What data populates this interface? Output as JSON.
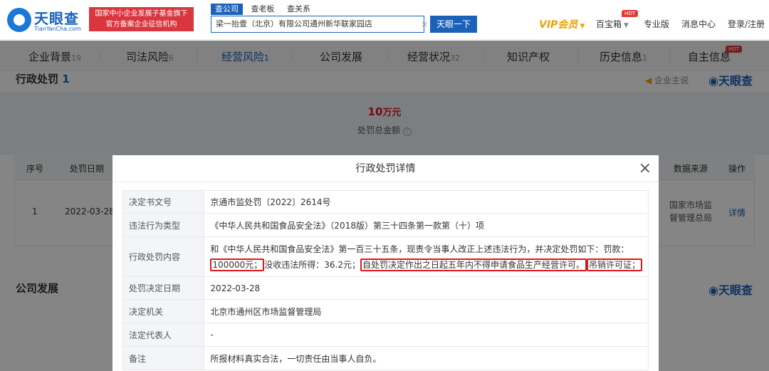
{
  "header": {
    "logo_name": "天眼查",
    "logo_domain": "TianYanCha.com",
    "slogan_line1": "国家中小企业发展子基金旗下",
    "slogan_line2": "官方备案企业征信机构",
    "search_tabs": [
      "查公司",
      "查老板",
      "查关系"
    ],
    "search_value": "梁一抬壹（北京）有限公司通州新华联家园店",
    "search_clear": "×",
    "search_button": "天眼一下",
    "vip_label": "VIP会员",
    "treasure_label": "百宝箱",
    "hot_badge": "HOT",
    "pro_label": "专业版",
    "message_label": "消息中心",
    "login_label": "登录/注册"
  },
  "nav": {
    "tabs": [
      {
        "label": "企业背景",
        "count": "19"
      },
      {
        "label": "司法风险",
        "count": "6"
      },
      {
        "label": "经营风险",
        "count": "1"
      },
      {
        "label": "公司发展",
        "count": ""
      },
      {
        "label": "经营状况",
        "count": "32"
      },
      {
        "label": "知识产权",
        "count": ""
      },
      {
        "label": "历史信息",
        "count": "1"
      },
      {
        "label": "自主信息",
        "count": ""
      }
    ],
    "hot_badge": "HOT"
  },
  "section": {
    "title": "行政处罚",
    "count": "1",
    "biz_label": "企业主说",
    "watermark": "天眼查",
    "summary_amount_num": "10",
    "summary_amount_unit": "万元",
    "summary_label": "处罚总金额",
    "table_headers": [
      "序号",
      "处罚日期",
      "数据来源",
      "操作"
    ],
    "row": {
      "index": "1",
      "date": "2022-03-28",
      "source_line1": "国家市场监",
      "source_line2": "督管理总局",
      "action": "详情"
    },
    "dev_title": "公司发展"
  },
  "modal": {
    "title": "行政处罚详情",
    "close": "×",
    "rows": [
      {
        "key": "决定书文号",
        "value": "京通市监处罚〔2022〕2614号"
      },
      {
        "key": "违法行为类型",
        "value": "《中华人民共和国食品安全法》（2018版）第三十四条第一款第（十）项"
      },
      {
        "key": "行政处罚内容",
        "value": ""
      },
      {
        "key": "处罚决定日期",
        "value": "2022-03-28"
      },
      {
        "key": "决定机关",
        "value": "北京市通州区市场监督管理局"
      },
      {
        "key": "法定代表人",
        "value": "-"
      },
      {
        "key": "备注",
        "value": "所报材料真实合法，一切责任由当事人自负。"
      }
    ],
    "content_line1": "和《中华人民共和国食品安全法》第一百三十五条，现责令当事人改正上述违法行为，并决定处罚如下：罚款：",
    "content_fine": "100000元；",
    "content_mid": "没收违法所得：36.2元；",
    "content_ban": "自处罚决定作出之日起五年内不得申请食品生产经营许可。",
    "content_revoke": "吊销许可证；"
  }
}
